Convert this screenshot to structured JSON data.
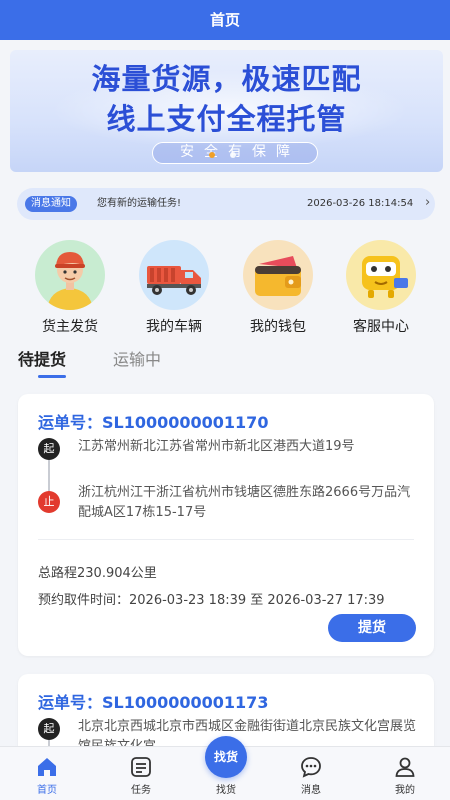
{
  "header": {
    "title": "首页"
  },
  "banner": {
    "line1": "海量货源，极速匹配",
    "line2": "线上支付全程托管",
    "slogan": "安全有保障"
  },
  "notice": {
    "tag": "消息通知",
    "message": "您有新的运输任务!",
    "time": "2026-03-26 18:14:54"
  },
  "menu": [
    {
      "label": "货主发货",
      "icon": "shipper-person-icon"
    },
    {
      "label": "我的车辆",
      "icon": "truck-icon"
    },
    {
      "label": "我的钱包",
      "icon": "wallet-icon"
    },
    {
      "label": "客服中心",
      "icon": "service-center-icon"
    }
  ],
  "tabs": [
    {
      "label": "待提货",
      "active": true
    },
    {
      "label": "运输中",
      "active": false
    }
  ],
  "orders": [
    {
      "order_no": "运单号：SL1000000001170",
      "start_badge": "起",
      "end_badge": "止",
      "from": "江苏常州新北江苏省常州市新北区港西大道19号",
      "to": "浙江杭州江干浙江省杭州市钱塘区德胜东路2666号万品汽配城A区17栋15-17号",
      "distance": "总路程230.904公里",
      "pickup_time": "预约取件时间：2026-03-23 18:39 至 2026-03-27 17:39",
      "action": "提货"
    },
    {
      "order_no": "运单号：SL1000000001173",
      "start_badge": "起",
      "from": "北京北京西城北京市西城区金融街街道北京民族文化宫展览馆民族文化宫"
    }
  ],
  "bottom_nav": [
    {
      "label": "首页",
      "icon": "home-icon",
      "active": true
    },
    {
      "label": "任务",
      "icon": "task-list-icon",
      "active": false
    },
    {
      "label": "找货",
      "icon": "find-goods-icon",
      "active": false
    },
    {
      "label": "消息",
      "icon": "message-icon",
      "active": false
    },
    {
      "label": "我的",
      "icon": "profile-icon",
      "active": false
    }
  ],
  "fab_label": "找货",
  "colors": {
    "primary": "#3b6ee8",
    "end_badge": "#e23a2e"
  }
}
